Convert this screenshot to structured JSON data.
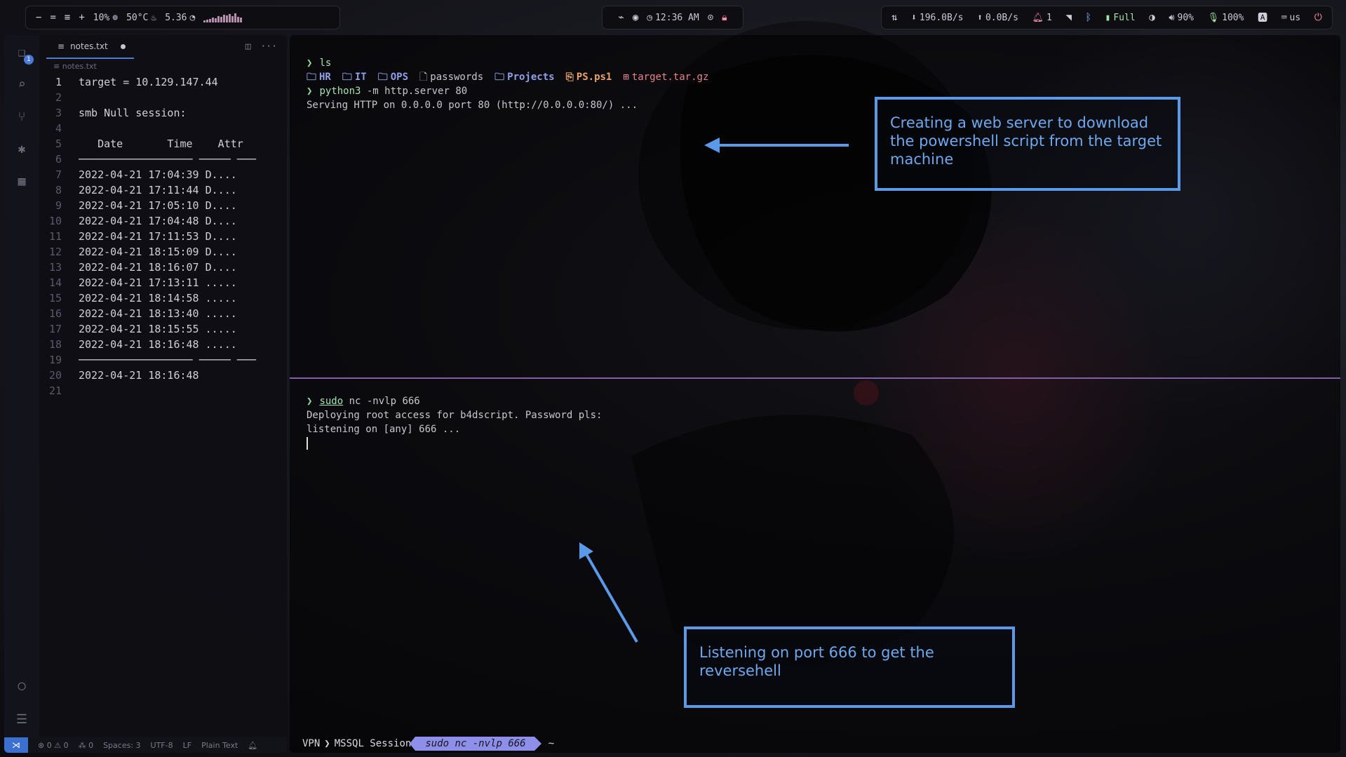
{
  "topbar": {
    "left": {
      "cpu": "10%",
      "temp": "50°C",
      "load": "5.36"
    },
    "center": {
      "time": "12:36 AM"
    },
    "right": {
      "down": "196.0B/s",
      "up": "0.0B/s",
      "notifications": "1",
      "battery": "Full",
      "volume": "90%",
      "mic": "100%",
      "layout": "us"
    }
  },
  "editor": {
    "tab_label": "notes.txt",
    "breadcrumb": "notes.txt",
    "explorer_badge": "1",
    "lines": [
      {
        "n": "1",
        "text": "target = 10.129.147.44"
      },
      {
        "n": "2",
        "text": ""
      },
      {
        "n": "3",
        "text": "smb Null session:"
      },
      {
        "n": "4",
        "text": ""
      },
      {
        "n": "5",
        "text": "   Date       Time    Attr"
      },
      {
        "n": "6",
        "text": "────────────────── ───── ───"
      },
      {
        "n": "7",
        "text": "2022-04-21 17:04:39 D...."
      },
      {
        "n": "8",
        "text": "2022-04-21 17:11:44 D...."
      },
      {
        "n": "9",
        "text": "2022-04-21 17:05:10 D...."
      },
      {
        "n": "10",
        "text": "2022-04-21 17:04:48 D...."
      },
      {
        "n": "11",
        "text": "2022-04-21 17:11:53 D...."
      },
      {
        "n": "12",
        "text": "2022-04-21 18:15:09 D...."
      },
      {
        "n": "13",
        "text": "2022-04-21 18:16:07 D...."
      },
      {
        "n": "14",
        "text": "2022-04-21 17:13:11 ....."
      },
      {
        "n": "15",
        "text": "2022-04-21 18:14:58 ....."
      },
      {
        "n": "16",
        "text": "2022-04-21 18:13:40 ....."
      },
      {
        "n": "17",
        "text": "2022-04-21 18:15:55 ....."
      },
      {
        "n": "18",
        "text": "2022-04-21 18:16:48 ....."
      },
      {
        "n": "19",
        "text": "────────────────── ───── ───"
      },
      {
        "n": "20",
        "text": "2022-04-21 18:16:48"
      },
      {
        "n": "21",
        "text": ""
      }
    ],
    "status": {
      "errors": "0",
      "warnings": "0",
      "ports": "0",
      "spaces": "Spaces: 3",
      "encoding": "UTF-8",
      "eol": "LF",
      "language": "Plain Text"
    }
  },
  "terminal": {
    "top": {
      "cmd1": "ls",
      "ls_items": [
        {
          "name": "HR",
          "kind": "dir"
        },
        {
          "name": "IT",
          "kind": "dir"
        },
        {
          "name": "OPS",
          "kind": "dir"
        },
        {
          "name": "passwords",
          "kind": "file"
        },
        {
          "name": "Projects",
          "kind": "dir"
        },
        {
          "name": "PS.ps1",
          "kind": "ps"
        },
        {
          "name": "target.tar.gz",
          "kind": "tar"
        }
      ],
      "cmd2_bin": "python3",
      "cmd2_args": " -m http.server 80",
      "out2": "Serving HTTP on 0.0.0.0 port 80 (http://0.0.0.0:80/) ..."
    },
    "bottom": {
      "cmd_sudo": "sudo",
      "cmd_args": " nc -nvlp 666",
      "out1": "Deploying root access for b4dscript. Password pls:",
      "out2": "listening on [any] 666 ..."
    },
    "statusline": {
      "seg1": "VPN",
      "seg2": "MSSQL Session",
      "active": "sudo nc -nvlp 666",
      "tail": "~"
    }
  },
  "annotations": {
    "web_server": "Creating a web server to download the powershell script from the target machine",
    "listener": "Listening on port 666 to get the reversehell"
  },
  "colors": {
    "accent": "#5b9ae8",
    "divider": "#7e5fa8",
    "prompt": "#8fe3a3",
    "active_segment": "#8d8fe8"
  }
}
